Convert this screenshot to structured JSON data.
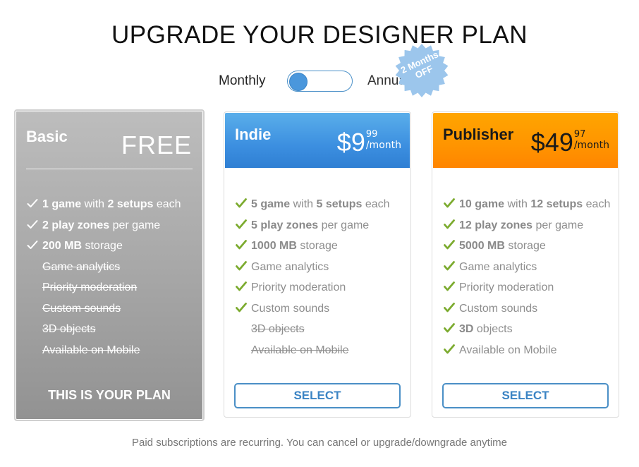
{
  "page": {
    "title": "UPGRADE YOUR DESIGNER PLAN",
    "footnote": "Paid subscriptions are recurring. You can cancel or upgrade/downgrade anytime"
  },
  "billing": {
    "monthly_label": "Monthly",
    "annual_label": "Annual",
    "selected": "Monthly",
    "badge_line1": "2 Months",
    "badge_line2": "OFF",
    "badge_color": "#9cc6ec",
    "toggle_color": "#4a97dc"
  },
  "plans": [
    {
      "name": "Basic",
      "price_label": "FREE",
      "current": true,
      "action_label": "THIS IS YOUR PLAN",
      "features": [
        {
          "included": true,
          "parts": [
            [
              "b",
              "1 game"
            ],
            [
              "t",
              " with "
            ],
            [
              "b",
              "2 setups"
            ],
            [
              "t",
              " each"
            ]
          ]
        },
        {
          "included": true,
          "parts": [
            [
              "b",
              "2 play zones"
            ],
            [
              "t",
              " per game"
            ]
          ]
        },
        {
          "included": true,
          "parts": [
            [
              "b",
              "200 MB"
            ],
            [
              "t",
              " storage"
            ]
          ]
        },
        {
          "included": false,
          "parts": [
            [
              "t",
              "Game analytics"
            ]
          ]
        },
        {
          "included": false,
          "parts": [
            [
              "t",
              "Priority moderation"
            ]
          ]
        },
        {
          "included": false,
          "parts": [
            [
              "t",
              "Custom sounds"
            ]
          ]
        },
        {
          "included": false,
          "parts": [
            [
              "t",
              "3D objects"
            ]
          ]
        },
        {
          "included": false,
          "parts": [
            [
              "t",
              "Available on Mobile"
            ]
          ]
        }
      ]
    },
    {
      "name": "Indie",
      "currency": "$",
      "price_main": "9",
      "price_cents": "99",
      "period": "/month",
      "header_color": "#3c8fe0",
      "action_label": "SELECT",
      "features": [
        {
          "included": true,
          "parts": [
            [
              "b",
              "5 game"
            ],
            [
              "t",
              " with "
            ],
            [
              "b",
              "5 setups"
            ],
            [
              "t",
              " each"
            ]
          ]
        },
        {
          "included": true,
          "parts": [
            [
              "b",
              "5 play zones"
            ],
            [
              "t",
              " per game"
            ]
          ]
        },
        {
          "included": true,
          "parts": [
            [
              "b",
              "1000 MB"
            ],
            [
              "t",
              " storage"
            ]
          ]
        },
        {
          "included": true,
          "parts": [
            [
              "t",
              "Game analytics"
            ]
          ]
        },
        {
          "included": true,
          "parts": [
            [
              "t",
              "Priority moderation"
            ]
          ]
        },
        {
          "included": true,
          "parts": [
            [
              "t",
              "Custom sounds"
            ]
          ]
        },
        {
          "included": false,
          "parts": [
            [
              "t",
              "3D objects"
            ]
          ]
        },
        {
          "included": false,
          "parts": [
            [
              "t",
              "Available on Mobile"
            ]
          ]
        }
      ]
    },
    {
      "name": "Publisher",
      "currency": "$",
      "price_main": "49",
      "price_cents": "97",
      "period": "/month",
      "header_color": "#ff9400",
      "action_label": "SELECT",
      "features": [
        {
          "included": true,
          "parts": [
            [
              "b",
              "10 game"
            ],
            [
              "t",
              " with "
            ],
            [
              "b",
              "12 setups"
            ],
            [
              "t",
              " each"
            ]
          ]
        },
        {
          "included": true,
          "parts": [
            [
              "b",
              "12 play zones"
            ],
            [
              "t",
              " per game"
            ]
          ]
        },
        {
          "included": true,
          "parts": [
            [
              "b",
              "5000 MB"
            ],
            [
              "t",
              " storage"
            ]
          ]
        },
        {
          "included": true,
          "parts": [
            [
              "t",
              "Game analytics"
            ]
          ]
        },
        {
          "included": true,
          "parts": [
            [
              "t",
              "Priority moderation"
            ]
          ]
        },
        {
          "included": true,
          "parts": [
            [
              "t",
              "Custom sounds"
            ]
          ]
        },
        {
          "included": true,
          "parts": [
            [
              "b",
              "3D"
            ],
            [
              "t",
              " objects"
            ]
          ]
        },
        {
          "included": true,
          "parts": [
            [
              "t",
              "Available on Mobile"
            ]
          ]
        }
      ]
    }
  ],
  "colors": {
    "check_green": "#7cab2f",
    "check_white": "#ffffff",
    "select_border": "#4a8fc6"
  }
}
